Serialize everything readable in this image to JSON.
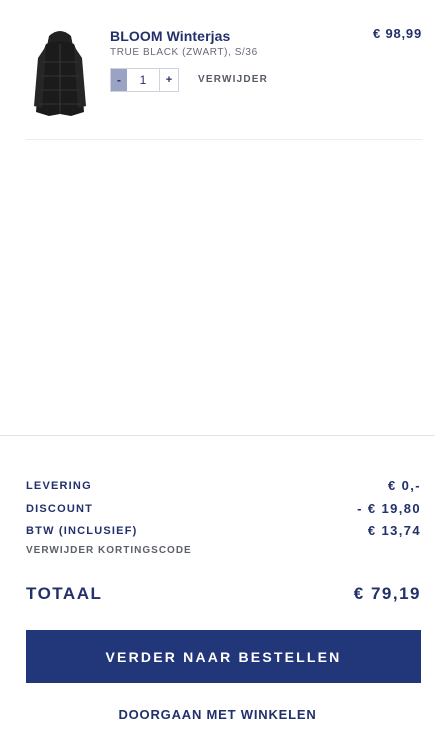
{
  "cart": {
    "items": [
      {
        "image_icon": "winter-jacket-image",
        "name": "BLOOM Winterjas",
        "variant": "TRUE BLACK (ZWART), S/36",
        "price": "€ 98,99",
        "quantity": "1",
        "minus_label": "-",
        "plus_label": "+",
        "remove_label": "VERWIJDER"
      }
    ]
  },
  "summary": {
    "delivery_label": "LEVERING",
    "delivery_value": "€ 0,-",
    "discount_label": "DISCOUNT",
    "discount_value": "- € 19,80",
    "vat_label": "BTW (INCLUSIEF)",
    "vat_value": "€ 13,74",
    "remove_code_label": "VERWIJDER KORTINGSCODE",
    "total_label": "TOTAAL",
    "total_value": "€ 79,19"
  },
  "actions": {
    "checkout_label": "VERDER NAAR BESTELLEN",
    "continue_label": "DOORGAAN MET WINKELEN"
  },
  "colors": {
    "brand_navy": "#22377a",
    "text_navy": "#22306b",
    "qty_minus_bg": "#9aa3c4"
  }
}
